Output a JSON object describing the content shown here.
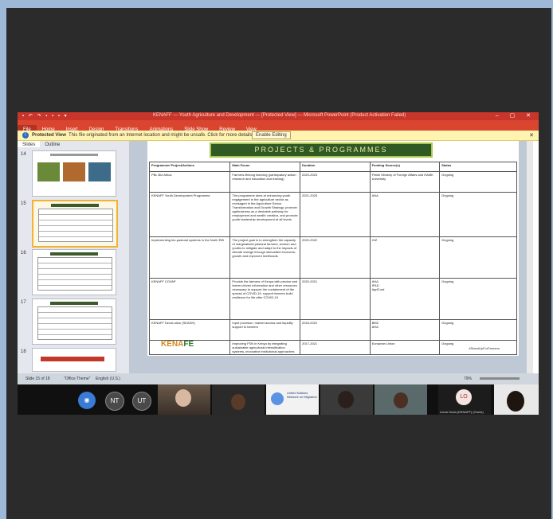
{
  "window": {
    "title": "KENAFF — Youth Agriculture and Development — [Protected View] — Microsoft PowerPoint (Product Activation Failed)",
    "quick_access": "▪ ↶ ↷ ▪ ▪ ▪ ▾",
    "controls": "– ▢ ✕"
  },
  "ribbon": {
    "tabs": [
      "File",
      "Home",
      "Insert",
      "Design",
      "Transitions",
      "Animations",
      "Slide Show",
      "Review",
      "View"
    ]
  },
  "protected_view": {
    "label": "Protected View",
    "message": "This file originated from an Internet location and might be unsafe. Click for more details.",
    "button": "Enable Editing",
    "close": "✕"
  },
  "left_pane": {
    "tabs": [
      "Slides",
      "Outline"
    ],
    "close": "✕",
    "thumbnails": [
      {
        "number": "14"
      },
      {
        "number": "15"
      },
      {
        "number": "16"
      },
      {
        "number": "17"
      },
      {
        "number": "18"
      }
    ]
  },
  "slide": {
    "title": "PROJECTS & PROGRAMMES",
    "table": {
      "headers": [
        "Programme/ Project/Actions",
        "Main Focus",
        "Duration",
        "Funding Source(s)",
        "Status"
      ],
      "rows": [
        [
          "PBL Bio Africa",
          "Farmers lifelong learning (participatory action research and education and training)",
          "2020-2023",
          "Finish Ministry of Foreign Affairs and HAMK University",
          "Ongoing"
        ],
        [
          "KENAFF Youth Development Programme",
          "The programme aims at enhancing youth engagement in the agriculture sector as envisaged in the Agriculture Sector Transformation and Growth Strategy; promote agribusiness as a desirable pathway for employment and wealth creation, and promote youth leadership development at all levels.",
          "2021-2025",
          "AHA",
          "Ongoing"
        ],
        [
          "Implementing bio-pastoral systems in the North Rift",
          "The project goal is to strengthen the capacity of marginalized pastoral farmers, women and youths to mitigate and adapt to the impacts of climate change through stimulated economic growth and improved livelihoods.",
          "2020-2022",
          "GIZ",
          "Ongoing"
        ],
        [
          "KENAFF COVAP",
          "Provide the farmers of Kenya with precise and farmer-driven information and other resources necessary to support the containment of the spread of COVID-19, support farmers build resilience for life after COVID-19",
          "2020-2021",
          "AHA\nIFAD\nAgriCord",
          "Ongoing"
        ],
        [
          "KENAFF DevoLution (SEADH)",
          "Input provision, market access and liquidity support to farmers",
          "2018-2022",
          "BMZ\nAHA",
          "Ongoing"
        ],
        [
          "",
          "Improving FSN in Kenya by integrating sustainable agricultural intensification systems, innovative institutional approaches",
          "2017-2021",
          "European Union",
          "Ongoing"
        ]
      ]
    },
    "logo_text": "KENA",
    "logo_text2": "FE",
    "hashtag": "#StandUpForFarmers"
  },
  "statusbar": {
    "slide_info": "Slide 15 of 18",
    "theme": "\"Office Theme\"",
    "language": "English (U.S.)",
    "zoom": "79%"
  },
  "participants": {
    "avatars": [
      {
        "initials": "",
        "color": "#3a7bd5"
      },
      {
        "initials": "NT",
        "color": "#4a4a4a"
      },
      {
        "initials": "UT",
        "color": "#4a4a4a"
      }
    ],
    "lo": {
      "initials": "LO",
      "label": "Linda Ouda (KENAFF) (Guest)"
    },
    "un_label": "United Nations Network on Migration"
  }
}
